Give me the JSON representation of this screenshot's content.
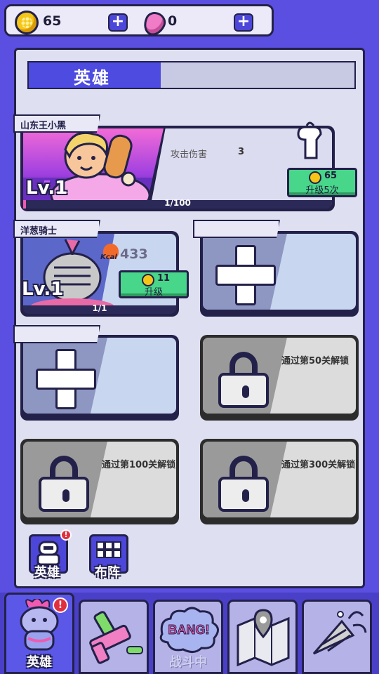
{
  "currency": {
    "coins": "65",
    "gems": "0"
  },
  "panel": {
    "title": "英雄"
  },
  "heroes": [
    {
      "name": "山东王小黑",
      "level": "Lv.1",
      "stat_label": "攻击伤害",
      "stat_value": "3",
      "upgrade_cost": "65",
      "upgrade_label": "升级5次",
      "progress_text": "1/100",
      "progress_fraction": 0.01
    },
    {
      "name": "洋葱骑士",
      "level": "Lv.1",
      "kcal_label": "Kcal",
      "kcal_value": "433",
      "upgrade_cost": "11",
      "upgrade_label": "升级",
      "progress_text": "1/1",
      "progress_fraction": 1.0
    }
  ],
  "locked_slots": [
    {
      "text": "通过第50关解锁"
    },
    {
      "text": "通过第100关解锁"
    },
    {
      "text": "通过第300关解锁"
    }
  ],
  "sub_tabs": [
    {
      "label": "英雄",
      "icon": "robot-icon",
      "alert": true
    },
    {
      "label": "布阵",
      "icon": "grid-icon",
      "alert": false
    }
  ],
  "nav": [
    {
      "label": "英雄",
      "icon": "hero-icon",
      "active": true,
      "alert": "!"
    },
    {
      "label": "",
      "icon": "weapon-icon",
      "active": false
    },
    {
      "label": "战斗中",
      "icon": "bang-icon",
      "active": false,
      "badge": "BANG!"
    },
    {
      "label": "",
      "icon": "map-icon",
      "active": false
    },
    {
      "label": "",
      "icon": "party-icon",
      "active": false
    }
  ],
  "colors": {
    "accent": "#4c47d8",
    "upgrade_green": "#48d68a",
    "progress_pink": "#f05ab0",
    "alert_red": "#e03040"
  }
}
